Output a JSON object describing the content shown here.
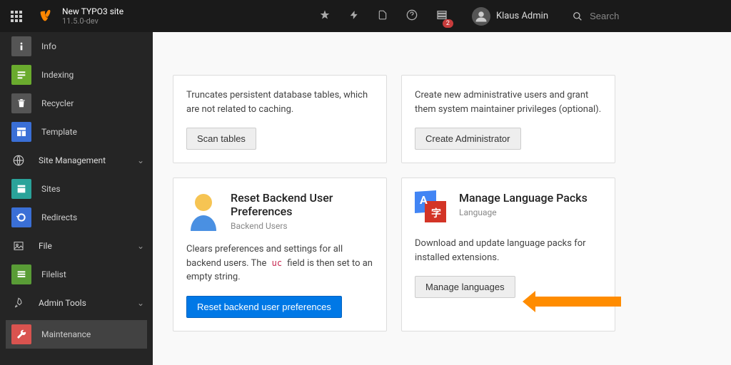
{
  "topbar": {
    "site_title": "New TYPO3 site",
    "version": "11.5.0-dev",
    "badge_count": "2",
    "user_name": "Klaus Admin",
    "search_placeholder": "Search"
  },
  "sidebar": {
    "info": "Info",
    "indexing": "Indexing",
    "recycler": "Recycler",
    "template": "Template",
    "site_management": "Site Management",
    "sites": "Sites",
    "redirects": "Redirects",
    "file": "File",
    "filelist": "Filelist",
    "admin_tools": "Admin Tools",
    "maintenance": "Maintenance"
  },
  "cards": {
    "scan": {
      "desc": "Truncates persistent database tables, which are not related to caching.",
      "btn": "Scan tables"
    },
    "admin": {
      "desc": "Create new administrative users and grant them system maintainer privileges (optional).",
      "btn": "Create Administrator"
    },
    "reset": {
      "title": "Reset Backend User Preferences",
      "subtitle": "Backend Users",
      "desc_a": "Clears preferences and settings for all backend users. The ",
      "desc_code": "uc",
      "desc_b": " field is then set to an empty string.",
      "btn": "Reset backend user preferences"
    },
    "lang": {
      "title": "Manage Language Packs",
      "subtitle": "Language",
      "desc": "Download and update language packs for installed extensions.",
      "btn": "Manage languages"
    }
  }
}
